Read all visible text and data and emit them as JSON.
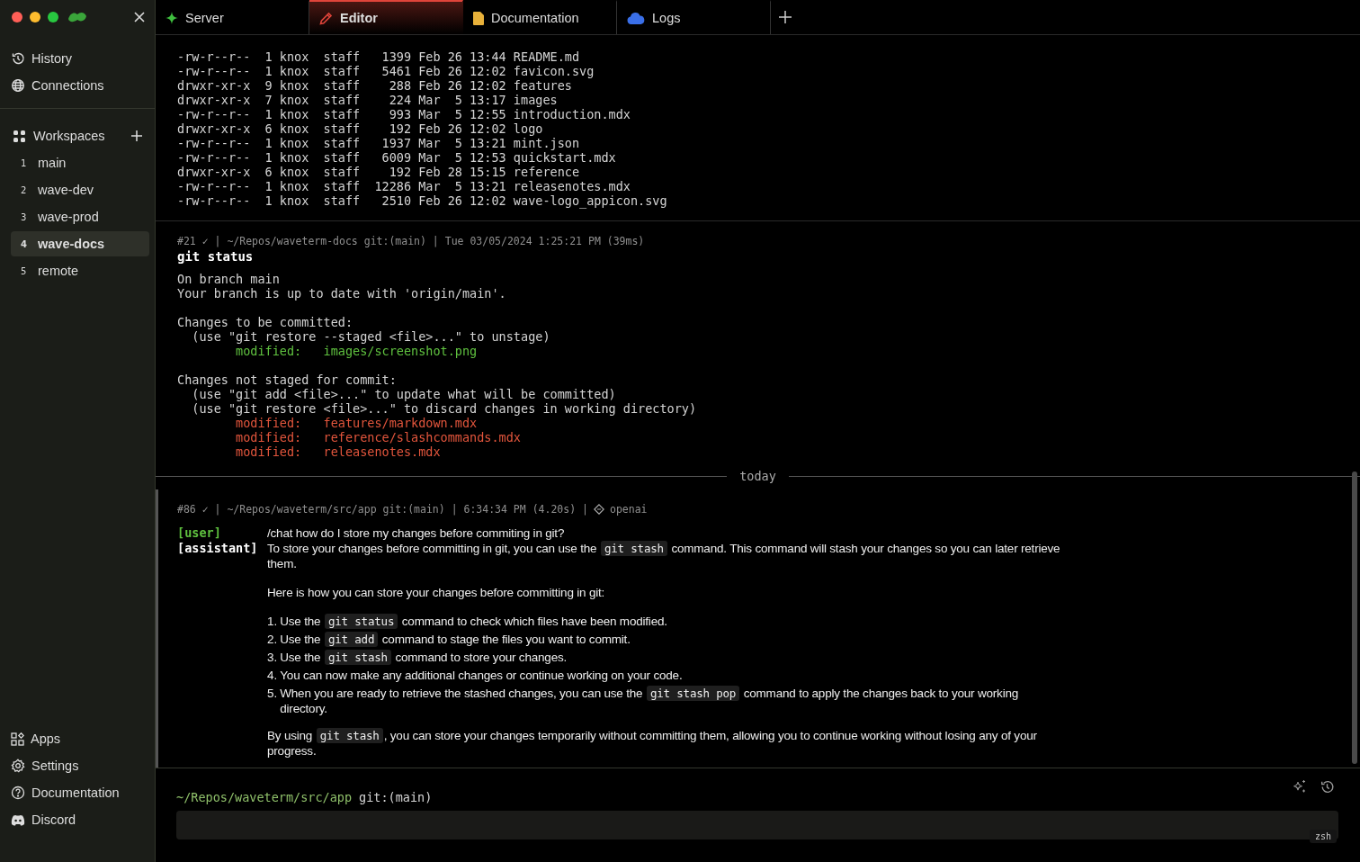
{
  "tabs": [
    {
      "label": "Server",
      "kind": "sparkle",
      "selected": false
    },
    {
      "label": "Editor",
      "kind": "pencil",
      "selected": true
    },
    {
      "label": "Documentation",
      "kind": "file",
      "selected": false
    },
    {
      "label": "Logs",
      "kind": "cloud",
      "selected": false
    }
  ],
  "sidebar": {
    "nav": [
      {
        "label": "History",
        "kind": "history"
      },
      {
        "label": "Connections",
        "kind": "globe"
      }
    ],
    "workspaces": {
      "title": "Workspaces",
      "items": [
        {
          "number": "1",
          "label": "main",
          "selected": false
        },
        {
          "number": "2",
          "label": "wave-dev",
          "selected": false
        },
        {
          "number": "3",
          "label": "wave-prod",
          "selected": false
        },
        {
          "number": "4",
          "label": "wave-docs",
          "selected": true
        },
        {
          "number": "5",
          "label": "remote",
          "selected": false
        }
      ]
    },
    "footer": [
      {
        "label": "Apps",
        "kind": "apps"
      },
      {
        "label": "Settings",
        "kind": "gear"
      },
      {
        "label": "Documentation",
        "kind": "help"
      },
      {
        "label": "Discord",
        "kind": "discord"
      }
    ]
  },
  "ls_lines": [
    "-rw-r--r--  1 knox  staff   1399 Feb 26 13:44 README.md",
    "-rw-r--r--  1 knox  staff   5461 Feb 26 12:02 favicon.svg",
    "drwxr-xr-x  9 knox  staff    288 Feb 26 12:02 features",
    "drwxr-xr-x  7 knox  staff    224 Mar  5 13:17 images",
    "-rw-r--r--  1 knox  staff    993 Mar  5 12:55 introduction.mdx",
    "drwxr-xr-x  6 knox  staff    192 Feb 26 12:02 logo",
    "-rw-r--r--  1 knox  staff   1937 Mar  5 13:21 mint.json",
    "-rw-r--r--  1 knox  staff   6009 Mar  5 12:53 quickstart.mdx",
    "drwxr-xr-x  6 knox  staff    192 Feb 28 15:15 reference",
    "-rw-r--r--  1 knox  staff  12286 Mar  5 13:21 releasenotes.mdx",
    "-rw-r--r--  1 knox  staff   2510 Feb 26 12:02 wave-logo_appicon.svg"
  ],
  "command_block": {
    "header": "#21 ✓ | ~/Repos/waveterm-docs git:(main) | Tue 03/05/2024 1:25:21 PM (39ms)",
    "command": "git status",
    "output": [
      [
        {
          "text": "On branch main",
          "kind": "normal"
        },
        {
          "text": "Your branch is up to date with 'origin/main'.",
          "kind": "normal"
        }
      ],
      [
        {
          "text": "Changes to be committed:",
          "kind": "normal"
        },
        {
          "text": "  (use \"git restore --staged <file>...\" to unstage)",
          "kind": "normal"
        },
        {
          "text": "        modified:   images/screenshot.png",
          "kind": "staged"
        }
      ],
      [
        {
          "text": "Changes not staged for commit:",
          "kind": "normal"
        },
        {
          "text": "  (use \"git add <file>...\" to update what will be committed)",
          "kind": "normal"
        },
        {
          "text": "  (use \"git restore <file>...\" to discard changes in working directory)",
          "kind": "normal"
        },
        {
          "text": "        modified:   features/markdown.mdx",
          "kind": "unstaged"
        },
        {
          "text": "        modified:   reference/slashcommands.mdx",
          "kind": "unstaged"
        },
        {
          "text": "        modified:   releasenotes.mdx",
          "kind": "unstaged"
        }
      ]
    ]
  },
  "separator": "today",
  "chat_block": {
    "header": "#86 ✓ | ~/Repos/waveterm/src/app git:(main) | 6:34:34 PM (4.20s) |",
    "model": "openai",
    "messages": [
      {
        "role": "[user]",
        "kind": "user",
        "content": [
          {
            "kind": "paragraph",
            "segments": [
              {
                "text": "/chat how do I store my changes before commiting in git?",
                "code": false
              }
            ]
          }
        ]
      },
      {
        "role": "[assistant]",
        "kind": "assistant",
        "content": [
          {
            "kind": "paragraph",
            "segments": [
              {
                "text": "To store your changes before committing in git, you can use the ",
                "code": false
              },
              {
                "text": "git stash",
                "code": true
              },
              {
                "text": " command. This command will stash your changes so you can later retrieve them.",
                "code": false
              }
            ]
          },
          {
            "kind": "paragraph",
            "segments": [
              {
                "text": "Here is how you can store your changes before committing in git:",
                "code": false
              }
            ]
          },
          {
            "kind": "list",
            "items": [
              {
                "number": "1.",
                "segments": [
                  {
                    "text": "Use the ",
                    "code": false
                  },
                  {
                    "text": "git status",
                    "code": true
                  },
                  {
                    "text": " command to check which files have been modified.",
                    "code": false
                  }
                ]
              },
              {
                "number": "2.",
                "segments": [
                  {
                    "text": "Use the ",
                    "code": false
                  },
                  {
                    "text": "git add",
                    "code": true
                  },
                  {
                    "text": " command to stage the files you want to commit.",
                    "code": false
                  }
                ]
              },
              {
                "number": "3.",
                "segments": [
                  {
                    "text": "Use the ",
                    "code": false
                  },
                  {
                    "text": "git stash",
                    "code": true
                  },
                  {
                    "text": " command to store your changes.",
                    "code": false
                  }
                ]
              },
              {
                "number": "4.",
                "segments": [
                  {
                    "text": "You can now make any additional changes or continue working on your code.",
                    "code": false
                  }
                ]
              },
              {
                "number": "5.",
                "segments": [
                  {
                    "text": "When you are ready to retrieve the stashed changes, you can use the ",
                    "code": false
                  },
                  {
                    "text": "git stash pop",
                    "code": true
                  },
                  {
                    "text": " command to apply the changes back to your working directory.",
                    "code": false
                  }
                ]
              }
            ]
          },
          {
            "kind": "paragraph",
            "segments": [
              {
                "text": "By using ",
                "code": false
              },
              {
                "text": "git stash",
                "code": true
              },
              {
                "text": ", you can store your changes temporarily without committing them, allowing you to continue working without losing any of your progress.",
                "code": false
              }
            ]
          }
        ]
      }
    ]
  },
  "prompt": {
    "cwd": "~/Repos/waveterm/src/app",
    "branch": "git:(main)",
    "shell": "zsh"
  }
}
